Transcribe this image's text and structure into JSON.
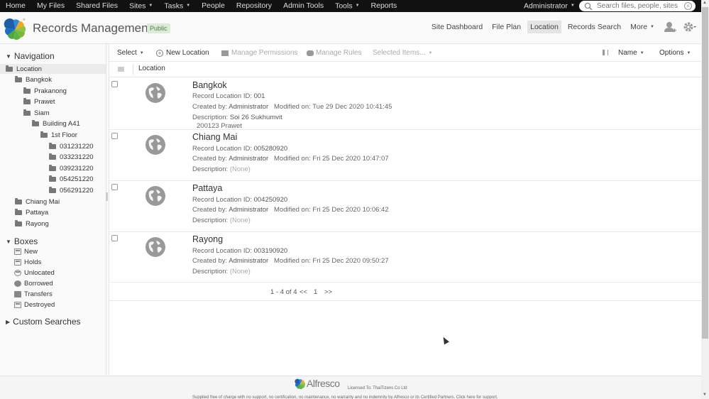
{
  "topnav": {
    "items": [
      {
        "label": "Home",
        "dropdown": false
      },
      {
        "label": "My Files",
        "dropdown": false
      },
      {
        "label": "Shared Files",
        "dropdown": false
      },
      {
        "label": "Sites",
        "dropdown": true
      },
      {
        "label": "Tasks",
        "dropdown": true
      },
      {
        "label": "People",
        "dropdown": false
      },
      {
        "label": "Repository",
        "dropdown": false
      },
      {
        "label": "Admin Tools",
        "dropdown": false
      },
      {
        "label": "Tools",
        "dropdown": true
      },
      {
        "label": "Reports",
        "dropdown": false
      }
    ],
    "user": "Administrator",
    "search_placeholder": "Search files, people, sites"
  },
  "header": {
    "title": "Records Management",
    "visibility": "Public",
    "nav": [
      {
        "label": "Site Dashboard",
        "active": false
      },
      {
        "label": "File Plan",
        "active": false
      },
      {
        "label": "Location",
        "active": true
      },
      {
        "label": "Records Search",
        "active": false
      },
      {
        "label": "More",
        "active": false
      }
    ]
  },
  "sidebar": {
    "navigation_title": "Navigation",
    "tree": [
      {
        "label": "Location",
        "level": 0,
        "selected": true
      },
      {
        "label": "Bangkok",
        "level": 1
      },
      {
        "label": "Prakanong",
        "level": 2
      },
      {
        "label": "Prawet",
        "level": 2
      },
      {
        "label": "Siam",
        "level": 2
      },
      {
        "label": "Building A41",
        "level": 3
      },
      {
        "label": "1st Floor",
        "level": 4
      },
      {
        "label": "031231220",
        "level": 5
      },
      {
        "label": "033231220",
        "level": 5
      },
      {
        "label": "039231220",
        "level": 5
      },
      {
        "label": "054251220",
        "level": 5
      },
      {
        "label": "056291220",
        "level": 5
      },
      {
        "label": "Chiang Mai",
        "level": 1
      },
      {
        "label": "Pattaya",
        "level": 1
      },
      {
        "label": "Rayong",
        "level": 1
      }
    ],
    "boxes_title": "Boxes",
    "boxes": [
      {
        "label": "New",
        "icon": "new-box-icon"
      },
      {
        "label": "Holds",
        "icon": "holds-icon"
      },
      {
        "label": "Unlocated",
        "icon": "unlocated-icon"
      },
      {
        "label": "Borrowed",
        "icon": "borrowed-icon"
      },
      {
        "label": "Transfers",
        "icon": "transfers-icon"
      },
      {
        "label": "Destroyed",
        "icon": "destroyed-icon"
      }
    ],
    "custom_searches_title": "Custom Searches"
  },
  "toolbar": {
    "select": "Select",
    "new_location": "New Location",
    "manage_permissions": "Manage Permissions",
    "manage_rules": "Manage Rules",
    "selected_items": "Selected Items...",
    "sort": "Name",
    "options": "Options"
  },
  "list": {
    "column_label": "Location",
    "id_label": "Record Location ID:",
    "created_label": "Created by:",
    "modified_label": "Modified on:",
    "description_label": "Description:",
    "rows": [
      {
        "name": "Bangkok",
        "id": "001",
        "created_by": "Administrator",
        "modified": "Tue 29 Dec 2020 10:41:45",
        "description": "Soi 26 Sukhumvit",
        "description2": "200123 Prawet"
      },
      {
        "name": "Chiang Mai",
        "id": "005280920",
        "created_by": "Administrator",
        "modified": "Fri 25 Dec 2020 10:47:07",
        "description": "(None)"
      },
      {
        "name": "Pattaya",
        "id": "004250920",
        "created_by": "Administrator",
        "modified": "Fri 25 Dec 2020 10:06:42",
        "description": "(None)"
      },
      {
        "name": "Rayong",
        "id": "003190920",
        "created_by": "Administrator",
        "modified": "Fri 25 Dec 2020 09:50:27",
        "description": "(None)"
      }
    ]
  },
  "pager": {
    "range": "1 - 4 of 4",
    "prev": "<<",
    "page": "1",
    "next": ">>"
  },
  "footer": {
    "brand": "Alfresco",
    "license": "Licensed To: ThaiTizens Co Ltd",
    "support": "Supplied free of charge with no support, no certification, no maintenance, no warranty and no indemnity by Alfresco or its Certified Partners. Click here for support."
  }
}
